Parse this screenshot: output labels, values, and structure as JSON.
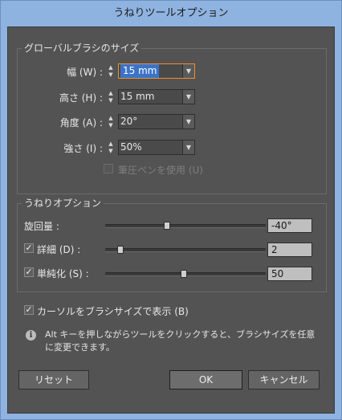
{
  "window": {
    "title": "うねりツールオプション"
  },
  "brush_size": {
    "legend": "グローバルブラシのサイズ",
    "width": {
      "label": "幅 (W) :",
      "value": "15 mm"
    },
    "height": {
      "label": "高さ (H) :",
      "value": "15 mm"
    },
    "angle": {
      "label": "角度 (A) :",
      "value": "20°"
    },
    "intensity": {
      "label": "強さ (I) :",
      "value": "50%"
    },
    "pressure_pen": {
      "label": "筆圧ペンを使用 (U)",
      "checked": false,
      "enabled": false
    }
  },
  "warp_options": {
    "legend": "うねりオプション",
    "rotation": {
      "label": "旋回量 :",
      "value": "-40°",
      "slider_fraction": 0.38
    },
    "detail": {
      "label": "詳細 (D) :",
      "value": "2",
      "checked": true,
      "slider_fraction": 0.08
    },
    "simplify": {
      "label": "単純化 (S) :",
      "value": "50",
      "checked": true,
      "slider_fraction": 0.49
    }
  },
  "show_brush_size": {
    "label": "カーソルをブラシサイズで表示 (B)",
    "checked": true
  },
  "info": {
    "icon": "info-icon",
    "line1": "Alt キーを押しながらツールをクリックすると、ブラシサイズを任意",
    "line2": "に変更できます。"
  },
  "buttons": {
    "reset": "リセット",
    "ok": "OK",
    "cancel": "キャンセル"
  },
  "colors": {
    "panel": "#535353",
    "titlebar": "#8fb3e0",
    "focus_border": "#e8922b",
    "selection": "#3c73c9"
  },
  "glyphs": {
    "check": "✓",
    "up": "▲",
    "down": "▼",
    "info": "i"
  }
}
